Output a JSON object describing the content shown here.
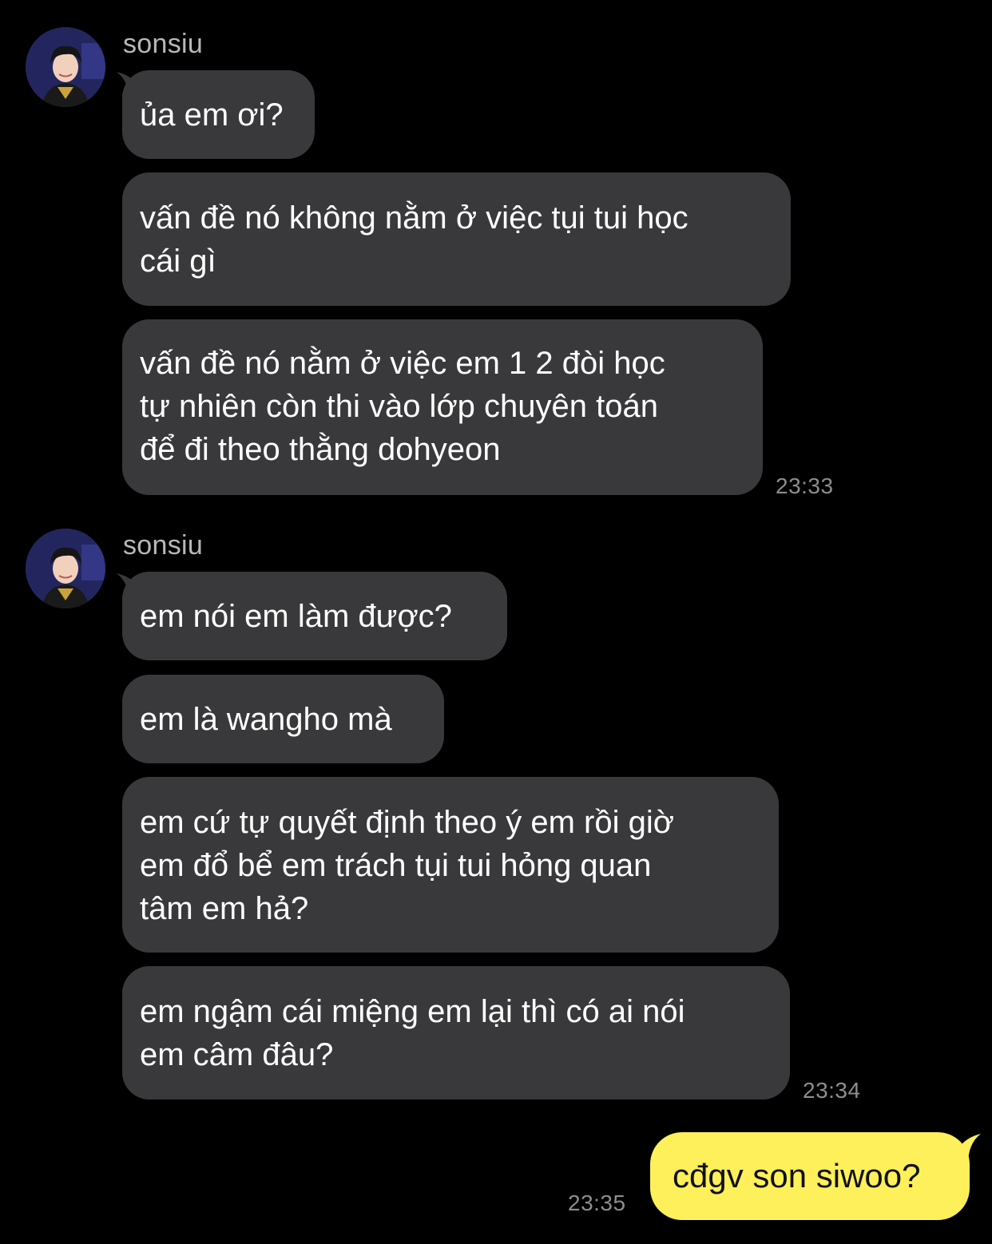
{
  "conversation": {
    "groups": [
      {
        "sender": "sonsiu",
        "avatar_icon": "profile-photo-avatar",
        "messages": [
          "ủa em ơi?",
          "vấn đề nó không nằm ở việc tụi tui học\ncái gì",
          "vấn đề nó nằm ở việc em 1 2 đòi học\ntự nhiên còn thi vào lớp chuyên toán\nđể đi theo thằng dohyeon"
        ],
        "time": "23:33"
      },
      {
        "sender": "sonsiu",
        "avatar_icon": "profile-photo-avatar",
        "messages": [
          "em nói em làm được?",
          "em là wangho mà",
          "em cứ tự quyết định theo ý em rồi giờ\nem đổ bể em trách tụi tui hỏng quan\ntâm em hả?",
          "em ngậm cái miệng em lại thì có ai nói\nem câm đâu?"
        ],
        "time": "23:34"
      }
    ],
    "outgoing": {
      "message": "cđgv son siwoo?",
      "time": "23:35"
    }
  },
  "colors": {
    "background": "#000000",
    "incoming_bubble": "#39393c",
    "outgoing_bubble": "#fdf05a",
    "timestamp": "#8d8d90",
    "sender_name": "#b8b8b8"
  }
}
